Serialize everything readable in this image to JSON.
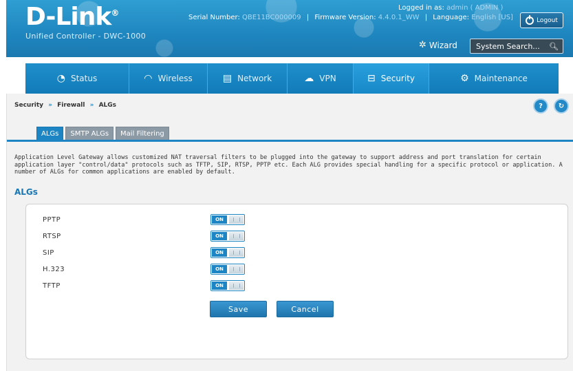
{
  "header": {
    "logo_text": "D-Link",
    "product": "Unified Controller - DWC-1000",
    "serial_label": "Serial Number:",
    "serial_value": "QBE11BC000009",
    "firmware_label": "Firmware Version:",
    "firmware_value": "4.4.0.1_WW",
    "language_label": "Language:",
    "language_value": "English [US]",
    "logged_in_label": "Logged in as:",
    "logged_in_value": "admin ( ADMIN )",
    "logout_label": "Logout",
    "wizard_label": "Wizard",
    "search_placeholder": "System Search..."
  },
  "nav": {
    "items": [
      {
        "label": "Status",
        "icon": "gauge-icon"
      },
      {
        "label": "Wireless",
        "icon": "wifi-icon"
      },
      {
        "label": "Network",
        "icon": "monitor-icon"
      },
      {
        "label": "VPN",
        "icon": "cloud-lock-icon"
      },
      {
        "label": "Security",
        "icon": "lock-icon"
      },
      {
        "label": "Maintenance",
        "icon": "gears-icon"
      }
    ]
  },
  "breadcrumb": {
    "items": [
      "Security",
      "Firewall",
      "ALGs"
    ],
    "separator": "»"
  },
  "tabs": [
    "ALGs",
    "SMTP ALGs",
    "Mail Filtering"
  ],
  "description": "Application Level Gateway allows customized NAT traversal filters to be plugged into the gateway to support address and port translation for certain application layer \"control/data\" protocols such as TFTP, SIP, RTSP, PPTP etc. Each ALG provides special handling for a specific protocol or application. A number of ALGs for common applications are enabled by default.",
  "section_title": "ALGs",
  "algs": [
    {
      "label": "PPTP",
      "state": "ON"
    },
    {
      "label": "RTSP",
      "state": "ON"
    },
    {
      "label": "SIP",
      "state": "ON"
    },
    {
      "label": "H.323",
      "state": "ON"
    },
    {
      "label": "TFTP",
      "state": "ON"
    }
  ],
  "buttons": {
    "save": "Save",
    "cancel": "Cancel"
  },
  "colors": {
    "brand_blue": "#1d85c4",
    "header_blue": "#2f9ed2"
  }
}
